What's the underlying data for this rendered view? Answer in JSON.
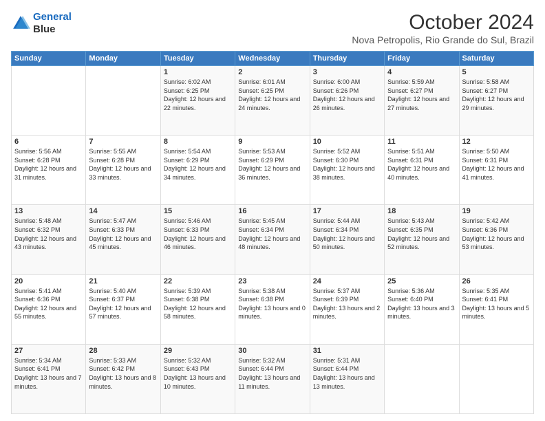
{
  "logo": {
    "line1": "General",
    "line2": "Blue"
  },
  "header": {
    "month": "October 2024",
    "location": "Nova Petropolis, Rio Grande do Sul, Brazil"
  },
  "weekdays": [
    "Sunday",
    "Monday",
    "Tuesday",
    "Wednesday",
    "Thursday",
    "Friday",
    "Saturday"
  ],
  "weeks": [
    [
      {
        "day": "",
        "sunrise": "",
        "sunset": "",
        "daylight": ""
      },
      {
        "day": "",
        "sunrise": "",
        "sunset": "",
        "daylight": ""
      },
      {
        "day": "1",
        "sunrise": "Sunrise: 6:02 AM",
        "sunset": "Sunset: 6:25 PM",
        "daylight": "Daylight: 12 hours and 22 minutes."
      },
      {
        "day": "2",
        "sunrise": "Sunrise: 6:01 AM",
        "sunset": "Sunset: 6:25 PM",
        "daylight": "Daylight: 12 hours and 24 minutes."
      },
      {
        "day": "3",
        "sunrise": "Sunrise: 6:00 AM",
        "sunset": "Sunset: 6:26 PM",
        "daylight": "Daylight: 12 hours and 26 minutes."
      },
      {
        "day": "4",
        "sunrise": "Sunrise: 5:59 AM",
        "sunset": "Sunset: 6:27 PM",
        "daylight": "Daylight: 12 hours and 27 minutes."
      },
      {
        "day": "5",
        "sunrise": "Sunrise: 5:58 AM",
        "sunset": "Sunset: 6:27 PM",
        "daylight": "Daylight: 12 hours and 29 minutes."
      }
    ],
    [
      {
        "day": "6",
        "sunrise": "Sunrise: 5:56 AM",
        "sunset": "Sunset: 6:28 PM",
        "daylight": "Daylight: 12 hours and 31 minutes."
      },
      {
        "day": "7",
        "sunrise": "Sunrise: 5:55 AM",
        "sunset": "Sunset: 6:28 PM",
        "daylight": "Daylight: 12 hours and 33 minutes."
      },
      {
        "day": "8",
        "sunrise": "Sunrise: 5:54 AM",
        "sunset": "Sunset: 6:29 PM",
        "daylight": "Daylight: 12 hours and 34 minutes."
      },
      {
        "day": "9",
        "sunrise": "Sunrise: 5:53 AM",
        "sunset": "Sunset: 6:29 PM",
        "daylight": "Daylight: 12 hours and 36 minutes."
      },
      {
        "day": "10",
        "sunrise": "Sunrise: 5:52 AM",
        "sunset": "Sunset: 6:30 PM",
        "daylight": "Daylight: 12 hours and 38 minutes."
      },
      {
        "day": "11",
        "sunrise": "Sunrise: 5:51 AM",
        "sunset": "Sunset: 6:31 PM",
        "daylight": "Daylight: 12 hours and 40 minutes."
      },
      {
        "day": "12",
        "sunrise": "Sunrise: 5:50 AM",
        "sunset": "Sunset: 6:31 PM",
        "daylight": "Daylight: 12 hours and 41 minutes."
      }
    ],
    [
      {
        "day": "13",
        "sunrise": "Sunrise: 5:48 AM",
        "sunset": "Sunset: 6:32 PM",
        "daylight": "Daylight: 12 hours and 43 minutes."
      },
      {
        "day": "14",
        "sunrise": "Sunrise: 5:47 AM",
        "sunset": "Sunset: 6:33 PM",
        "daylight": "Daylight: 12 hours and 45 minutes."
      },
      {
        "day": "15",
        "sunrise": "Sunrise: 5:46 AM",
        "sunset": "Sunset: 6:33 PM",
        "daylight": "Daylight: 12 hours and 46 minutes."
      },
      {
        "day": "16",
        "sunrise": "Sunrise: 5:45 AM",
        "sunset": "Sunset: 6:34 PM",
        "daylight": "Daylight: 12 hours and 48 minutes."
      },
      {
        "day": "17",
        "sunrise": "Sunrise: 5:44 AM",
        "sunset": "Sunset: 6:34 PM",
        "daylight": "Daylight: 12 hours and 50 minutes."
      },
      {
        "day": "18",
        "sunrise": "Sunrise: 5:43 AM",
        "sunset": "Sunset: 6:35 PM",
        "daylight": "Daylight: 12 hours and 52 minutes."
      },
      {
        "day": "19",
        "sunrise": "Sunrise: 5:42 AM",
        "sunset": "Sunset: 6:36 PM",
        "daylight": "Daylight: 12 hours and 53 minutes."
      }
    ],
    [
      {
        "day": "20",
        "sunrise": "Sunrise: 5:41 AM",
        "sunset": "Sunset: 6:36 PM",
        "daylight": "Daylight: 12 hours and 55 minutes."
      },
      {
        "day": "21",
        "sunrise": "Sunrise: 5:40 AM",
        "sunset": "Sunset: 6:37 PM",
        "daylight": "Daylight: 12 hours and 57 minutes."
      },
      {
        "day": "22",
        "sunrise": "Sunrise: 5:39 AM",
        "sunset": "Sunset: 6:38 PM",
        "daylight": "Daylight: 12 hours and 58 minutes."
      },
      {
        "day": "23",
        "sunrise": "Sunrise: 5:38 AM",
        "sunset": "Sunset: 6:38 PM",
        "daylight": "Daylight: 13 hours and 0 minutes."
      },
      {
        "day": "24",
        "sunrise": "Sunrise: 5:37 AM",
        "sunset": "Sunset: 6:39 PM",
        "daylight": "Daylight: 13 hours and 2 minutes."
      },
      {
        "day": "25",
        "sunrise": "Sunrise: 5:36 AM",
        "sunset": "Sunset: 6:40 PM",
        "daylight": "Daylight: 13 hours and 3 minutes."
      },
      {
        "day": "26",
        "sunrise": "Sunrise: 5:35 AM",
        "sunset": "Sunset: 6:41 PM",
        "daylight": "Daylight: 13 hours and 5 minutes."
      }
    ],
    [
      {
        "day": "27",
        "sunrise": "Sunrise: 5:34 AM",
        "sunset": "Sunset: 6:41 PM",
        "daylight": "Daylight: 13 hours and 7 minutes."
      },
      {
        "day": "28",
        "sunrise": "Sunrise: 5:33 AM",
        "sunset": "Sunset: 6:42 PM",
        "daylight": "Daylight: 13 hours and 8 minutes."
      },
      {
        "day": "29",
        "sunrise": "Sunrise: 5:32 AM",
        "sunset": "Sunset: 6:43 PM",
        "daylight": "Daylight: 13 hours and 10 minutes."
      },
      {
        "day": "30",
        "sunrise": "Sunrise: 5:32 AM",
        "sunset": "Sunset: 6:44 PM",
        "daylight": "Daylight: 13 hours and 11 minutes."
      },
      {
        "day": "31",
        "sunrise": "Sunrise: 5:31 AM",
        "sunset": "Sunset: 6:44 PM",
        "daylight": "Daylight: 13 hours and 13 minutes."
      },
      {
        "day": "",
        "sunrise": "",
        "sunset": "",
        "daylight": ""
      },
      {
        "day": "",
        "sunrise": "",
        "sunset": "",
        "daylight": ""
      }
    ]
  ]
}
